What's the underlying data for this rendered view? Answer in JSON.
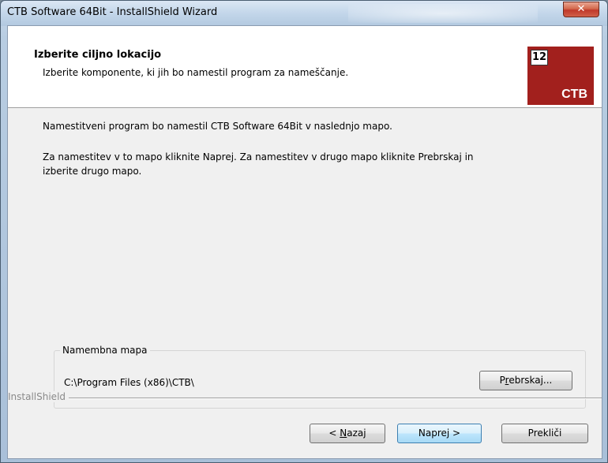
{
  "window": {
    "title": "CTB Software 64Bit - InstallShield Wizard",
    "close_glyph": "✕"
  },
  "header": {
    "title": "Izberite ciljno  lokacijo",
    "subtitle": "Izberite komponente, ki jih bo namestil program za nameščanje.",
    "logo_badge": "12",
    "logo_text": "CTB"
  },
  "main": {
    "line1": "Namestitveni program bo namestil CTB Software 64Bit v naslednjo mapo.",
    "line2": "Za namestitev v to mapo kliknite Naprej. Za namestitev v drugo mapo kliknite Prebrskaj in",
    "line3": "izberite drugo mapo."
  },
  "destination": {
    "legend": "Namembna mapa",
    "path": "C:\\Program Files (x86)\\CTB\\",
    "browse_label_pre": "P",
    "browse_label_mnemonic": "r",
    "browse_label_post": "ebrskaj..."
  },
  "footer": {
    "brand": "InstallShield",
    "back_pre": "< ",
    "back_mnemonic": "N",
    "back_post": "azaj",
    "next_label": "Naprej >",
    "cancel_label": "Prekliči"
  },
  "colors": {
    "logo_bg": "#a2201d",
    "close_btn": "#c0392b",
    "focus_border": "#3c7fb1"
  }
}
